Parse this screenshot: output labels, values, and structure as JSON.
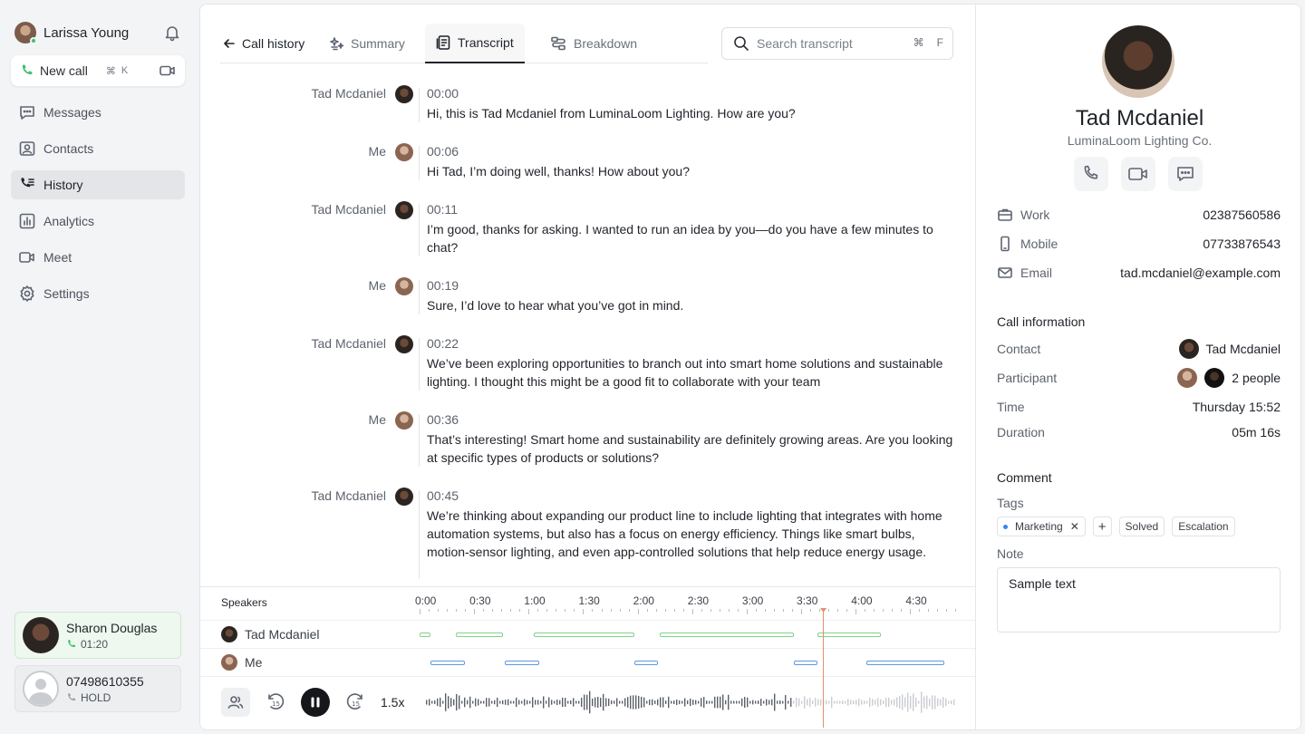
{
  "user": {
    "name": "Larissa Young"
  },
  "new_call": {
    "label": "New call",
    "shortcut_cmd": "⌘",
    "shortcut_key": "K"
  },
  "nav": [
    {
      "label": "Messages",
      "icon": "message-icon"
    },
    {
      "label": "Contacts",
      "icon": "contacts-icon"
    },
    {
      "label": "History",
      "icon": "history-icon",
      "active": true
    },
    {
      "label": "Analytics",
      "icon": "analytics-icon"
    },
    {
      "label": "Meet",
      "icon": "video-icon"
    },
    {
      "label": "Settings",
      "icon": "gear-icon"
    }
  ],
  "active_calls": [
    {
      "name": "Sharon Douglas",
      "status": "01:20"
    },
    {
      "name": "07498610355",
      "status": "HOLD"
    }
  ],
  "tabs": {
    "back": "Call history",
    "summary": "Summary",
    "transcript": "Transcript",
    "breakdown": "Breakdown"
  },
  "search": {
    "placeholder": "Search transcript",
    "kbd1": "⌘",
    "kbd2": "F"
  },
  "transcript": [
    {
      "speaker": "Tad Mcdaniel",
      "time": "00:00",
      "text": "Hi, this is Tad Mcdaniel from LuminaLoom Lighting. How are you?"
    },
    {
      "speaker": "Me",
      "time": "00:06",
      "text": "Hi Tad, I’m doing well, thanks! How about you?"
    },
    {
      "speaker": "Tad Mcdaniel",
      "time": "00:11",
      "text": "I’m good, thanks for asking. I wanted to run an idea by you—do you have a few minutes to chat?"
    },
    {
      "speaker": "Me",
      "time": "00:19",
      "text": "Sure, I’d love to hear what you’ve got in mind."
    },
    {
      "speaker": "Tad Mcdaniel",
      "time": "00:22",
      "text": "We’ve been exploring opportunities to branch out into smart home solutions and sustainable lighting. I thought this might be a good fit to collaborate with your team"
    },
    {
      "speaker": "Me",
      "time": "00:36",
      "text": "That’s interesting! Smart home and sustainability are definitely growing areas. Are you looking at specific types of products or solutions?"
    },
    {
      "speaker": "Tad Mcdaniel",
      "time": "00:45",
      "text": "We’re thinking about expanding our product line to include lighting that integrates with home automation systems, but also has a focus on energy efficiency. Things like smart bulbs, motion-sensor lighting, and even app-controlled solutions that help reduce energy usage."
    }
  ],
  "player": {
    "speakers_label": "Speakers",
    "ticks": [
      "0:00",
      "0:30",
      "1:00",
      "1:30",
      "2:00",
      "2:30",
      "3:00",
      "3:30",
      "4:00",
      "4:30"
    ],
    "lanes": [
      {
        "name": "Tad Mcdaniel",
        "segments": [
          [
            0,
            6
          ],
          [
            20,
            46
          ],
          [
            63,
            118
          ],
          [
            132,
            206
          ],
          [
            219,
            254
          ]
        ]
      },
      {
        "name": "Me",
        "segments": [
          [
            6,
            25
          ],
          [
            47,
            66
          ],
          [
            118,
            131
          ],
          [
            206,
            219
          ],
          [
            246,
            289
          ]
        ]
      }
    ],
    "duration_seconds": 316,
    "position_seconds": 222,
    "speed": "1.5x"
  },
  "contact": {
    "name": "Tad Mcdaniel",
    "company": "LuminaLoom Lighting Co.",
    "work_label": "Work",
    "work": "02387560586",
    "mobile_label": "Mobile",
    "mobile": "07733876543",
    "email_label": "Email",
    "email": "tad.mcdaniel@example.com"
  },
  "call_info": {
    "title": "Call information",
    "contact_label": "Contact",
    "contact": "Tad Mcdaniel",
    "participant_label": "Participant",
    "participant": "2 people",
    "time_label": "Time",
    "time": "Thursday 15:52",
    "duration_label": "Duration",
    "duration": "05m 16s"
  },
  "comment": {
    "title": "Comment",
    "tags_label": "Tags",
    "tags": [
      "Marketing",
      "Solved",
      "Escalation"
    ],
    "note_label": "Note",
    "note": "Sample text"
  },
  "colors": {
    "accent_green": "#3cc26b",
    "tad_segment": "#7fd38a",
    "me_segment": "#5b9ae0",
    "playhead": "#e3906f"
  }
}
